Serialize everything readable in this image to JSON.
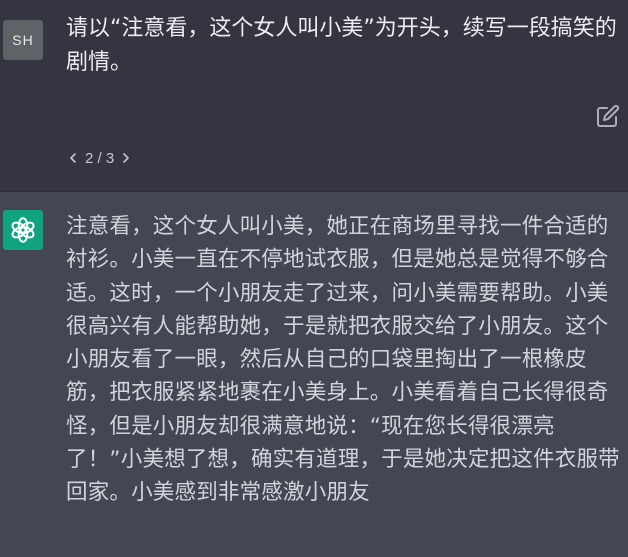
{
  "user_message": {
    "avatar_initials": "SH",
    "text": "请以“注意看，这个女人叫小美”为开头，续写一段搞笑的剧情。",
    "edit_icon": "edit-icon"
  },
  "pager": {
    "prev_icon": "chevron-left-icon",
    "label": "2 / 3",
    "next_icon": "chevron-right-icon"
  },
  "assistant_message": {
    "avatar_icon": "openai-logo-icon",
    "text": "注意看，这个女人叫小美，她正在商场里寻找一件合适的衬衫。小美一直在不停地试衣服，但是她总是觉得不够合适。这时，一个小朋友走了过来，问小美需要帮助。小美很高兴有人能帮助她，于是就把衣服交给了小朋友。这个小朋友看了一眼，然后从自己的口袋里掏出了一根橡皮筋，把衣服紧紧地裹在小美身上。小美看着自己长得很奇怪，但是小朋友却很满意地说：“现在您长得很漂亮了！”小美想了想，确实有道理，于是她决定把这件衣服带回家。小美感到非常感激小朋友"
  },
  "colors": {
    "user_bg": "#343541",
    "assistant_bg": "#444654",
    "user_avatar_bg": "#5f6368",
    "bot_avatar_bg": "#10a37f",
    "text": "#d1d5db"
  }
}
